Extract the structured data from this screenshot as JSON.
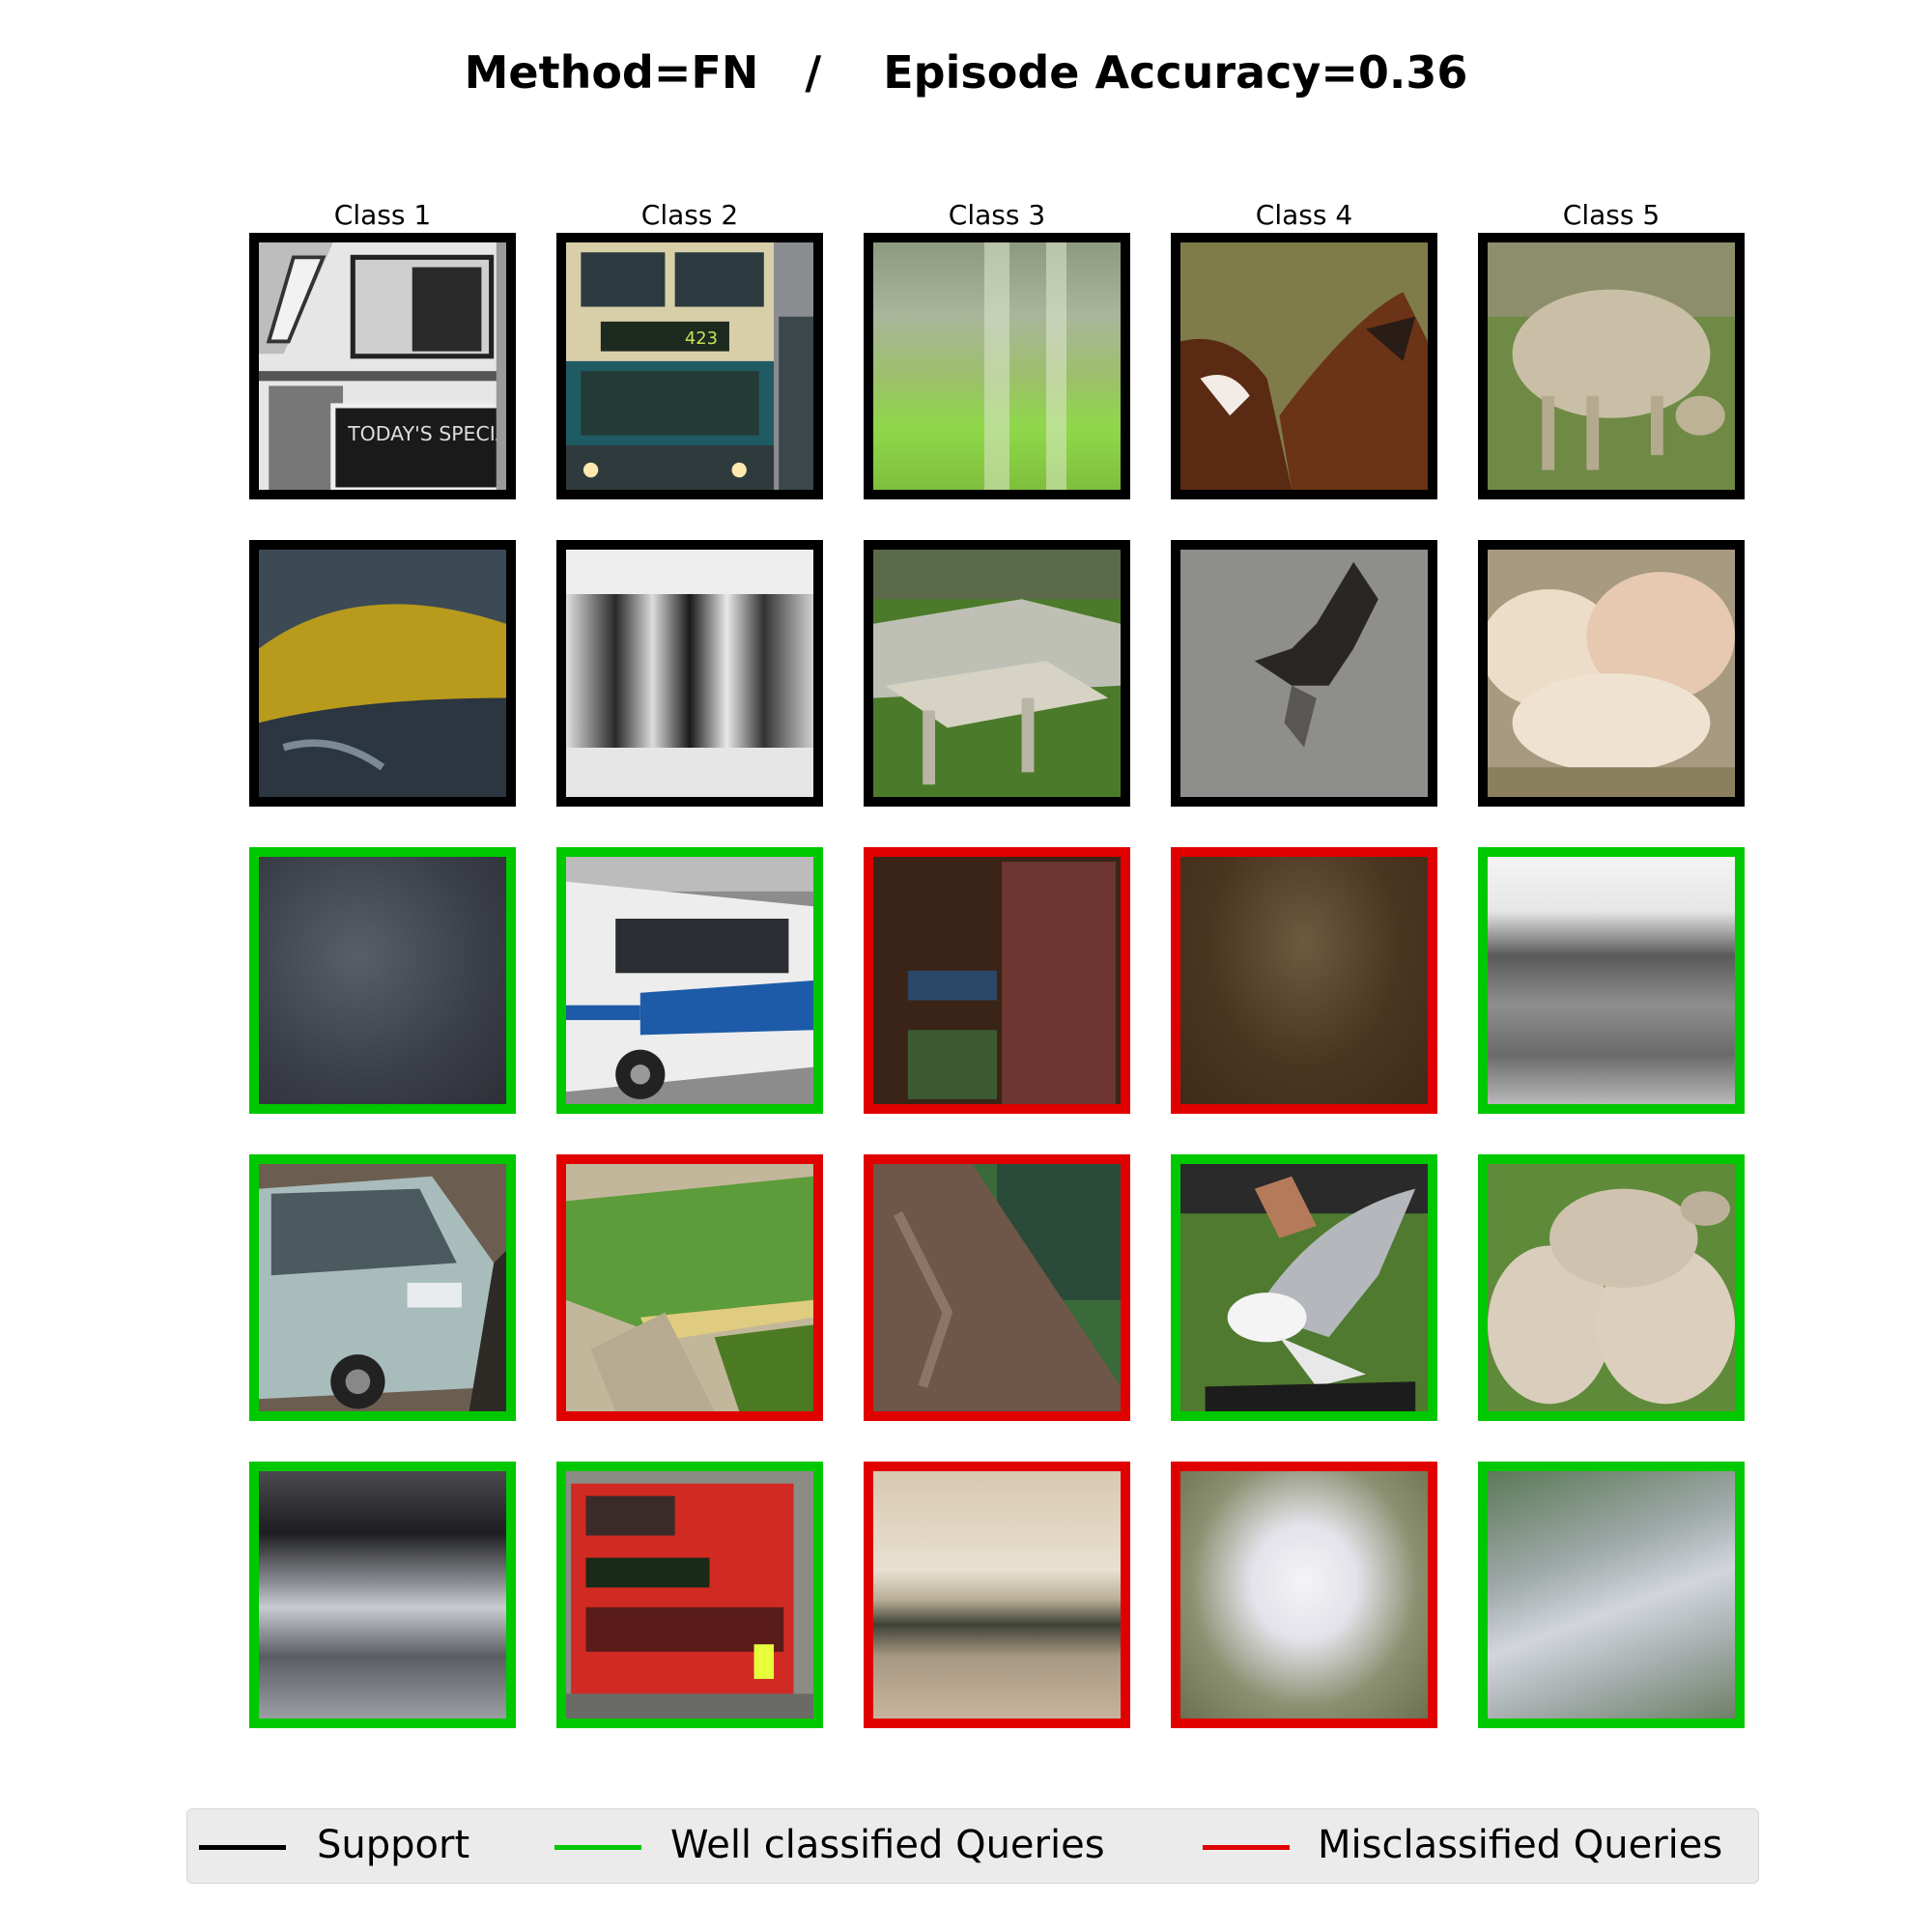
{
  "title": "Method=FN   /    Episode Accuracy=0.36",
  "colors": {
    "support": "#000000",
    "well": "#00c800",
    "mis": "#e00000"
  },
  "columns": [
    "Class 1",
    "Class 2",
    "Class 3",
    "Class 4",
    "Class 5"
  ],
  "rows": [
    [
      "support",
      "support",
      "support",
      "support",
      "support"
    ],
    [
      "support",
      "support",
      "support",
      "support",
      "support"
    ],
    [
      "well",
      "well",
      "mis",
      "mis",
      "well"
    ],
    [
      "well",
      "mis",
      "mis",
      "well",
      "well"
    ],
    [
      "well",
      "well",
      "mis",
      "mis",
      "well"
    ]
  ],
  "legend": {
    "support": "Support",
    "well": "Well classified Queries",
    "mis": "Misclassified Queries"
  },
  "signs": {
    "specials": "TODAY'S SPECIAL",
    "bus_route": "423"
  }
}
